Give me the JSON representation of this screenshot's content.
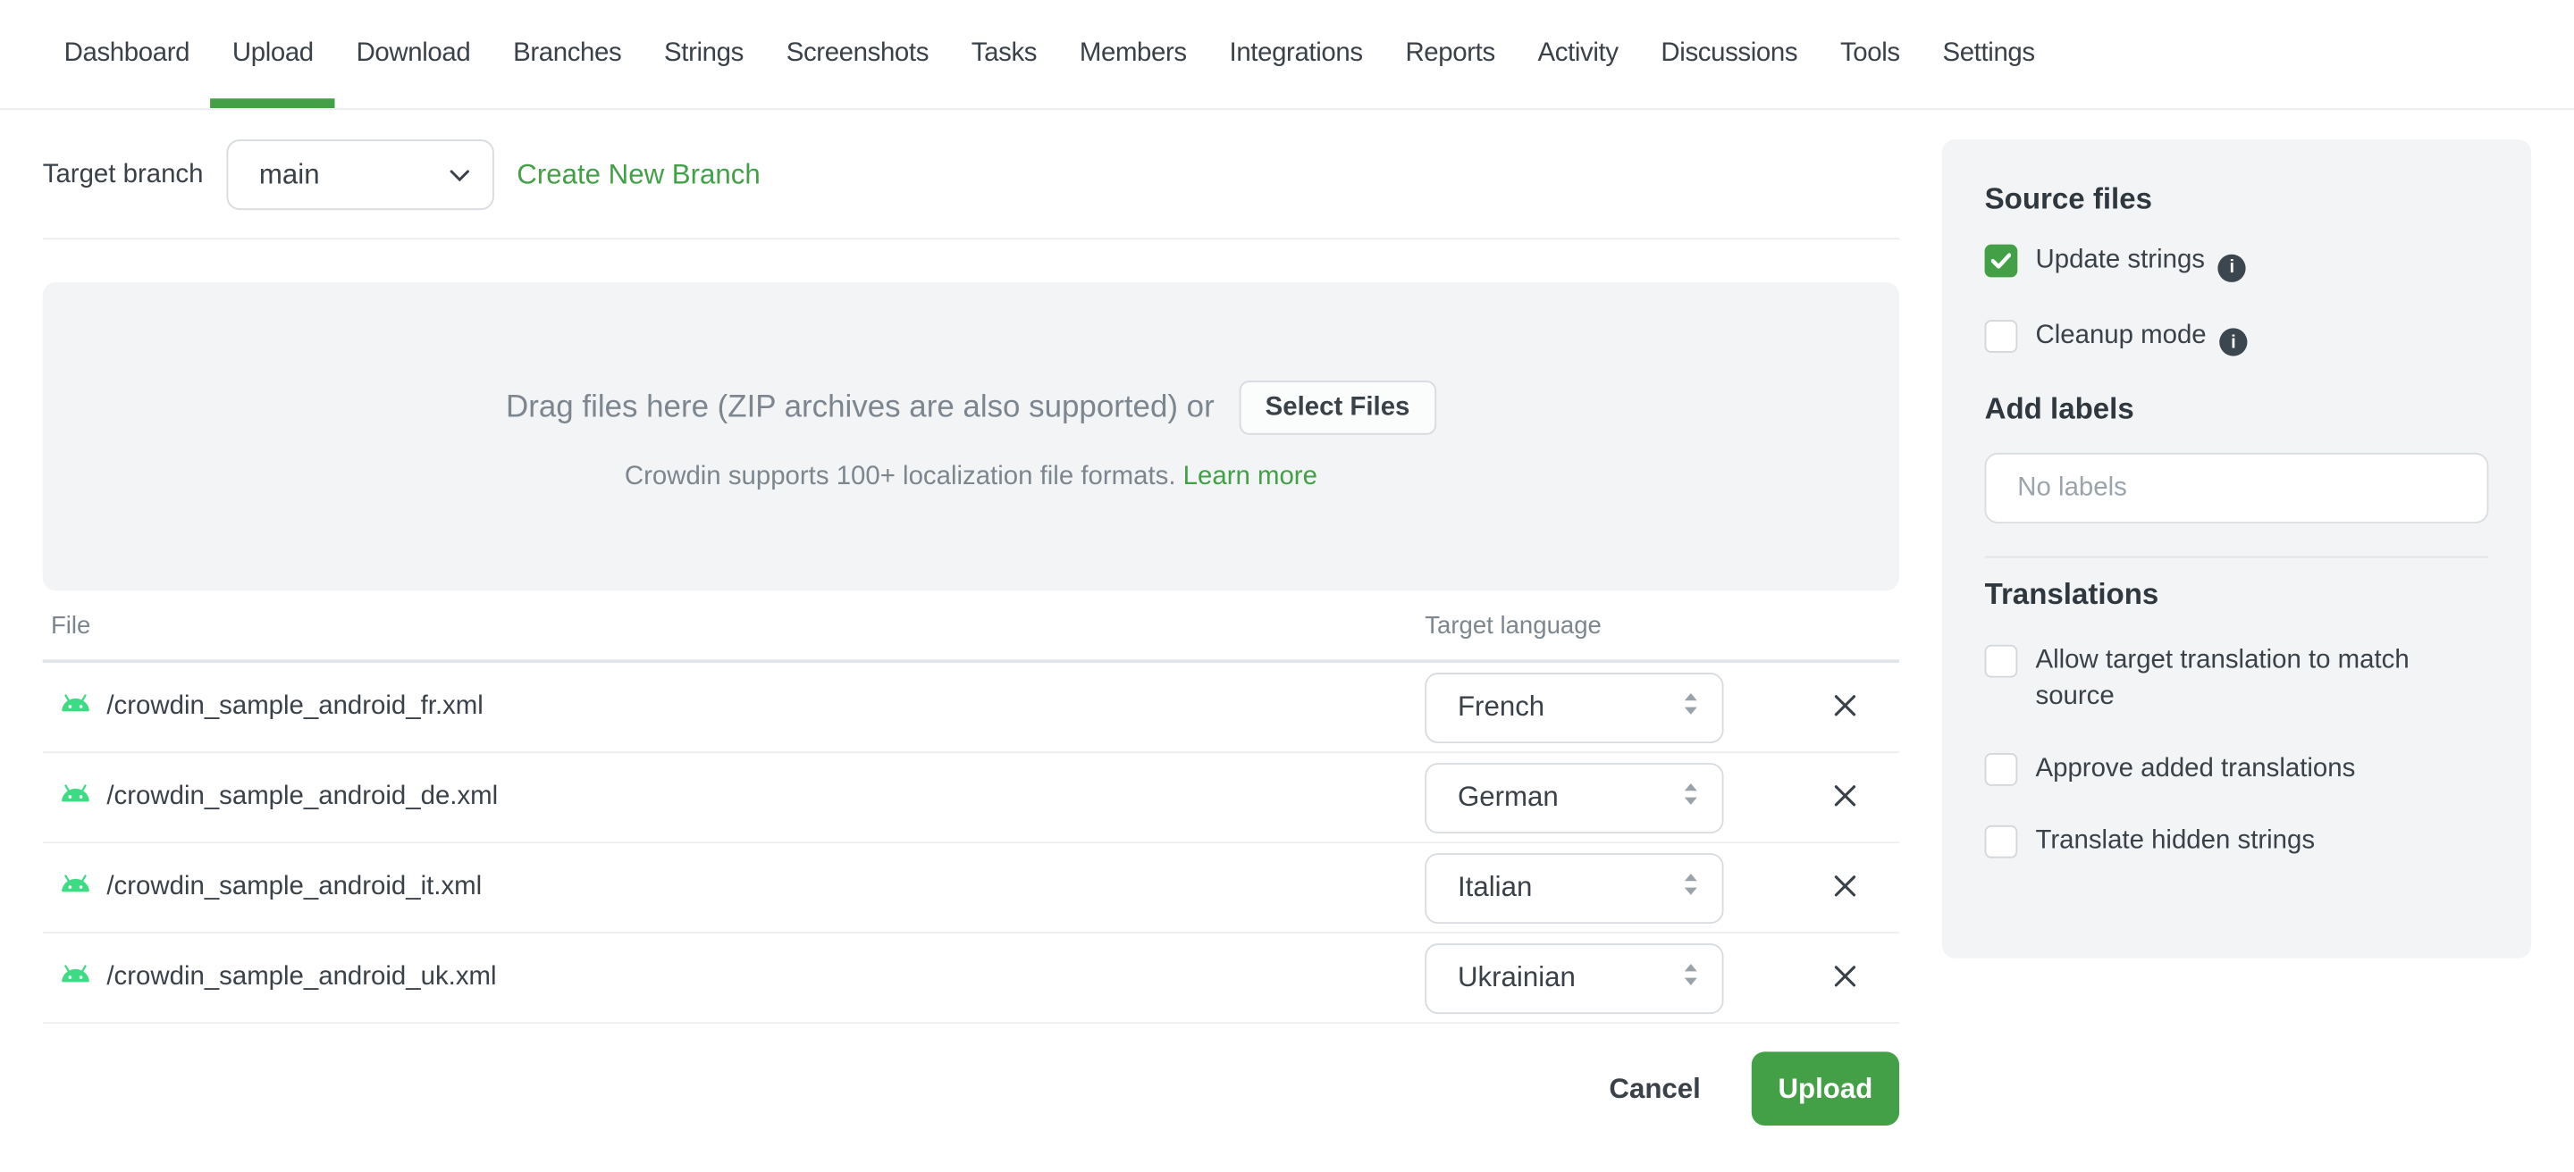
{
  "nav": {
    "items": [
      {
        "label": "Dashboard",
        "active": false
      },
      {
        "label": "Upload",
        "active": true
      },
      {
        "label": "Download",
        "active": false
      },
      {
        "label": "Branches",
        "active": false
      },
      {
        "label": "Strings",
        "active": false
      },
      {
        "label": "Screenshots",
        "active": false
      },
      {
        "label": "Tasks",
        "active": false
      },
      {
        "label": "Members",
        "active": false
      },
      {
        "label": "Integrations",
        "active": false
      },
      {
        "label": "Reports",
        "active": false
      },
      {
        "label": "Activity",
        "active": false
      },
      {
        "label": "Discussions",
        "active": false
      },
      {
        "label": "Tools",
        "active": false
      },
      {
        "label": "Settings",
        "active": false
      }
    ]
  },
  "branch_bar": {
    "label": "Target branch",
    "selected_branch": "main",
    "create_link": "Create New Branch"
  },
  "dropzone": {
    "line1": "Drag files here (ZIP archives are also supported) or",
    "select_button": "Select Files",
    "line2": "Crowdin supports 100+ localization file formats.",
    "learn_more": "Learn more"
  },
  "table": {
    "columns": {
      "file": "File",
      "target_language": "Target language"
    },
    "rows": [
      {
        "file": "/crowdin_sample_android_fr.xml",
        "language": "French"
      },
      {
        "file": "/crowdin_sample_android_de.xml",
        "language": "German"
      },
      {
        "file": "/crowdin_sample_android_it.xml",
        "language": "Italian"
      },
      {
        "file": "/crowdin_sample_android_uk.xml",
        "language": "Ukrainian"
      }
    ]
  },
  "footer": {
    "cancel": "Cancel",
    "upload": "Upload"
  },
  "sidebar": {
    "source_files": {
      "title": "Source files",
      "options": [
        {
          "label": "Update strings",
          "checked": true,
          "info": true
        },
        {
          "label": "Cleanup mode",
          "checked": false,
          "info": true
        }
      ]
    },
    "labels": {
      "title": "Add labels",
      "placeholder": "No labels",
      "value": ""
    },
    "translations": {
      "title": "Translations",
      "options": [
        {
          "label": "Allow target translation to match source",
          "checked": false,
          "info": false
        },
        {
          "label": "Approve added translations",
          "checked": false,
          "info": false
        },
        {
          "label": "Translate hidden strings",
          "checked": false,
          "info": false
        }
      ]
    }
  },
  "icons": {
    "info_glyph": "i"
  },
  "colors": {
    "accent_green": "#43a047",
    "android_green": "#3ddc84",
    "text_dark": "#3a4148",
    "text_grey": "#7d868f",
    "panel_bg": "#f2f4f6"
  }
}
